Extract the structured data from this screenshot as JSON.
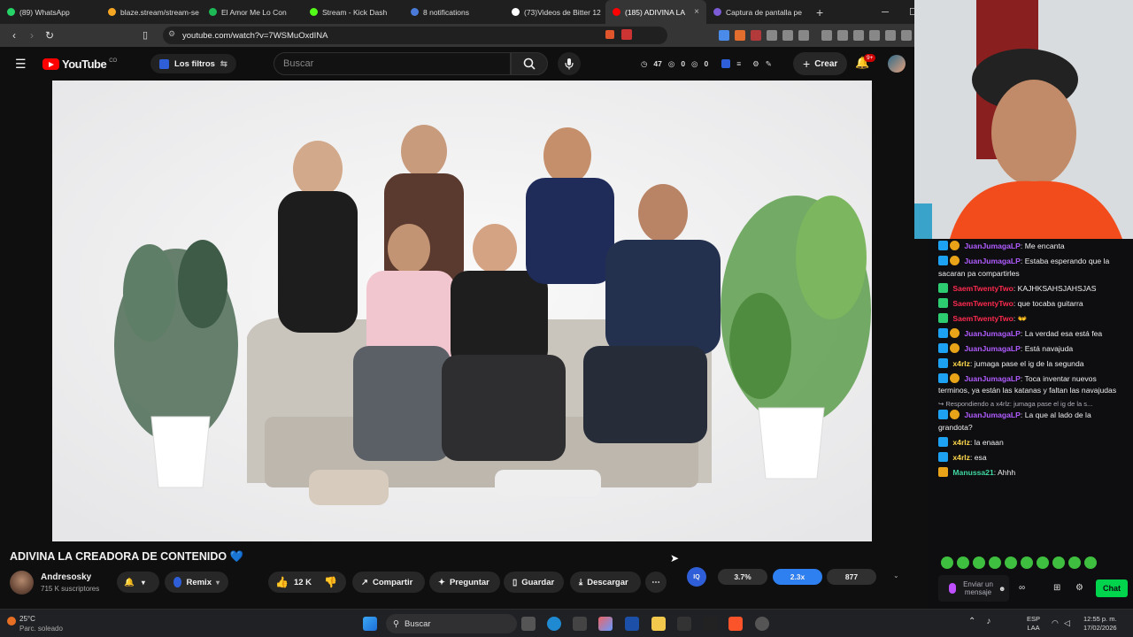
{
  "browser": {
    "tabs": [
      {
        "label": "(89) WhatsApp",
        "color": "#25d366"
      },
      {
        "label": "blaze.stream/stream-se",
        "color": "#f5a623"
      },
      {
        "label": "El Amor Me Lo Con",
        "color": "#1db954"
      },
      {
        "label": "Stream - Kick Dash",
        "color": "#53fc18"
      },
      {
        "label": "8 notifications",
        "color": "#4a7bd8"
      },
      {
        "label": "(73)Videos de Bitter 12",
        "color": "#ffffff"
      },
      {
        "label": "(185) ADIVINA LA",
        "color": "#ff0000"
      },
      {
        "label": "Captura de pantalla pe",
        "color": "#7b5cd6"
      }
    ],
    "active_tab_close": "×",
    "new_tab": "+",
    "url": "youtube.com/watch?v=7WSMuOxdINA"
  },
  "youtube": {
    "logo_text": "YouTube",
    "country": "CO",
    "filters_label": "Los filtros",
    "search_placeholder": "Buscar",
    "stats": {
      "a": "47",
      "b": "0",
      "c": "0"
    },
    "create_label": "Crear",
    "notif_count": "9+",
    "video_title": "ADIVINA LA CREADORA DE CONTENIDO 💙",
    "channel_name": "Andresosky",
    "subscribers": "715 K suscriptores",
    "remix_label": "Remix",
    "likes": "12 K",
    "share_label": "Compartir",
    "ask_label": "Preguntar",
    "save_label": "Guardar",
    "download_label": "Descargar",
    "iq_label": "IQ",
    "metrics": {
      "m1": "3.7%",
      "m2": "2.3x",
      "m3": "877"
    }
  },
  "chat": {
    "messages": [
      {
        "user": "JuanJumagaLP",
        "text": "Me encanta",
        "color": "#b05cff"
      },
      {
        "user": "JuanJumagaLP",
        "text": "Estaba esperando que la sacaran pa compartirles",
        "color": "#b05cff"
      },
      {
        "user": "SaemTwentyTwo",
        "text": "KAJHKSAHSJAHSJAS",
        "color": "#ff2a4f"
      },
      {
        "user": "SaemTwentyTwo",
        "text": "que tocaba guitarra",
        "color": "#ff2a4f"
      },
      {
        "user": "SaemTwentyTwo",
        "text": "👐",
        "color": "#ff2a4f"
      },
      {
        "user": "JuanJumagaLP",
        "text": "La verdad esa está fea",
        "color": "#b05cff"
      },
      {
        "user": "JuanJumagaLP",
        "text": "Está navajuda",
        "color": "#b05cff"
      },
      {
        "user": "x4rlz",
        "text": "jumaga pase el ig de la segunda",
        "color": "#ffd84d"
      },
      {
        "user": "JuanJumagaLP",
        "text": "Toca inventar nuevos terminos, ya están las katanas y faltan las navajudas",
        "color": "#b05cff"
      }
    ],
    "reply_context": "Respondiendo a x4rlz: jumaga pase el ig de la s...",
    "messages2": [
      {
        "user": "JuanJumagaLP",
        "text": "La que al lado de la grandota?",
        "color": "#b05cff"
      },
      {
        "user": "x4rlz",
        "text": "la enaan",
        "color": "#ffd84d"
      },
      {
        "user": "x4rlz",
        "text": "esa",
        "color": "#ffd84d"
      },
      {
        "user": "Manussa21",
        "text": "Ahhh",
        "color": "#3fd6a0"
      }
    ],
    "input_placeholder": "Enviar un mensaje",
    "chat_button": "Chat"
  },
  "taskbar": {
    "temp": "25°C",
    "weather": "Parc. soleado",
    "search": "Buscar",
    "lang1": "ESP",
    "lang2": "LAA",
    "time": "12:55 p. m.",
    "date": "17/02/2026"
  }
}
